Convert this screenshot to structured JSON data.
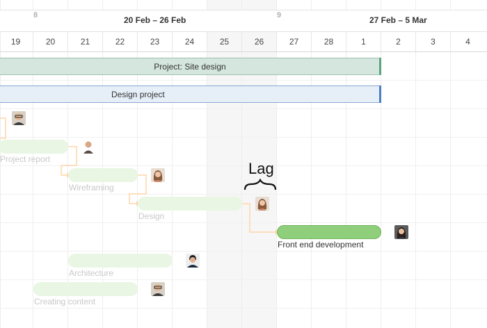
{
  "timeline": {
    "weeks": [
      {
        "number": "8",
        "label": "20 Feb – 26 Feb"
      },
      {
        "number": "9",
        "label": "27 Feb – 5 Mar"
      }
    ],
    "days": [
      "19",
      "20",
      "21",
      "22",
      "23",
      "24",
      "25",
      "26",
      "27",
      "28",
      "1",
      "2",
      "3",
      "4"
    ]
  },
  "summary_bars": {
    "site_design": "Project: Site design",
    "design_project": "Design project"
  },
  "tasks": {
    "project_report": "Project report",
    "wireframing": "Wireframing",
    "design": "Design",
    "front_end": "Front end development",
    "architecture": "Architecture",
    "creating_content": "Creating content"
  },
  "annotation": {
    "lag": "Lag"
  },
  "colors": {
    "summary_fill": "#d4e6dd",
    "project_fill": "#e6eef8",
    "active_task": "#8fce7a",
    "faded_task": "#e9f6e3",
    "dependency_line": "#ffd5a8"
  }
}
